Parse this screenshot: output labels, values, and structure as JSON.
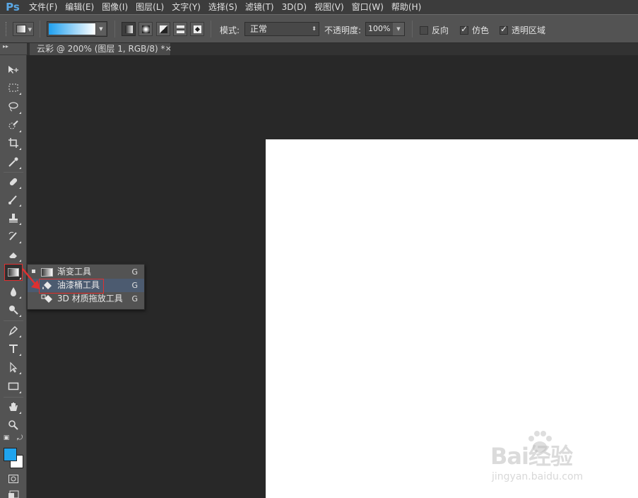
{
  "app": {
    "logo": "Ps"
  },
  "menu": [
    "文件(F)",
    "编辑(E)",
    "图像(I)",
    "图层(L)",
    "文字(Y)",
    "选择(S)",
    "滤镜(T)",
    "3D(D)",
    "视图(V)",
    "窗口(W)",
    "帮助(H)"
  ],
  "options": {
    "mode_label": "模式:",
    "mode_value": "正常",
    "opacity_label": "不透明度:",
    "opacity_value": "100%",
    "reverse_label": "反向",
    "reverse_checked": false,
    "dither_label": "仿色",
    "dither_checked": true,
    "transparency_label": "透明区域",
    "transparency_checked": true,
    "gradient_colors": [
      "#1fa0ef",
      "#ffffff"
    ]
  },
  "document": {
    "tab_title": "云彩 @ 200% (图层 1, RGB/8) *",
    "close_glyph": "×"
  },
  "flyout": {
    "items": [
      {
        "label": "渐变工具",
        "key": "G",
        "icon": "gradient-icon",
        "selected": true
      },
      {
        "label": "油漆桶工具",
        "key": "G",
        "icon": "paint-bucket-icon",
        "highlighted": true
      },
      {
        "label": "3D 材质拖放工具",
        "key": "G",
        "icon": "3d-material-drop-icon"
      }
    ]
  },
  "colors": {
    "foreground": "#1fa4ef",
    "background": "#ffffff",
    "highlight_box": "#e03030"
  },
  "watermark": {
    "main": "Bai经验",
    "sub": "jingyan.baidu.com"
  }
}
